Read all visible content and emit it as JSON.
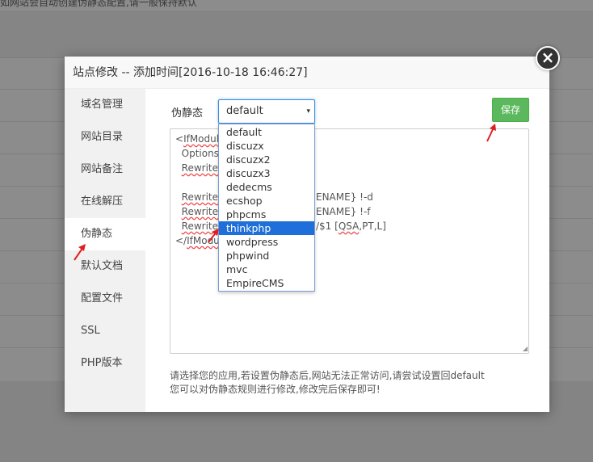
{
  "background": {
    "top_note": "如网站会自动创建伪静态配置,请一般保持默认"
  },
  "dialog": {
    "title": "站点修改 -- 添加时间[2016-10-18 16:46:27]",
    "close_symbol": "×"
  },
  "sidebar": {
    "items": [
      {
        "label": "域名管理"
      },
      {
        "label": "网站目录"
      },
      {
        "label": "网站备注"
      },
      {
        "label": "在线解压"
      },
      {
        "label": "伪静态"
      },
      {
        "label": "默认文档"
      },
      {
        "label": "配置文件"
      },
      {
        "label": "SSL"
      },
      {
        "label": "PHP版本"
      }
    ],
    "active_index": 4
  },
  "rewrite": {
    "label": "伪静态",
    "selected": "default",
    "caret": "▾",
    "save_label": "保存",
    "options": [
      "default",
      "discuzx",
      "discuzx2",
      "discuzx3",
      "dedecms",
      "ecshop",
      "phpcms",
      "thinkphp",
      "wordpress",
      "phpwind",
      "mvc",
      "EmpireCMS"
    ],
    "highlighted": "thinkphp"
  },
  "editor": {
    "lines": [
      {
        "a": "<",
        "b": "IfModul",
        "c": ""
      },
      {
        "a": "  Options",
        "b": "",
        "c": ""
      },
      {
        "a": "  ",
        "b": "RewriteE",
        "c": ""
      },
      {
        "a": "",
        "b": "",
        "c": ""
      },
      {
        "a": "  ",
        "b": "RewriteC",
        "c": ""
      },
      {
        "a": "  ",
        "b": "RewriteC",
        "c": ""
      },
      {
        "a": "  ",
        "b": "RewriteF",
        "c": ""
      },
      {
        "a": "</",
        "b": "IfModu",
        "c": ""
      }
    ],
    "right_fragments": [
      "ENAME} !-d",
      "ENAME} !-f",
      "/$1 [",
      "QSA",
      ",PT,L]"
    ]
  },
  "hint": {
    "line1": "请选择您的应用,若设置伪静态后,网站无法正常访问,请尝试设置回default",
    "line2": "您可以对伪静态规则进行修改,修改完后保存即可!"
  },
  "colors": {
    "accent": "#3c8dde",
    "save_green": "#5cb85c",
    "selection_blue": "#1e6fd9",
    "arrow_red": "#e02020"
  }
}
